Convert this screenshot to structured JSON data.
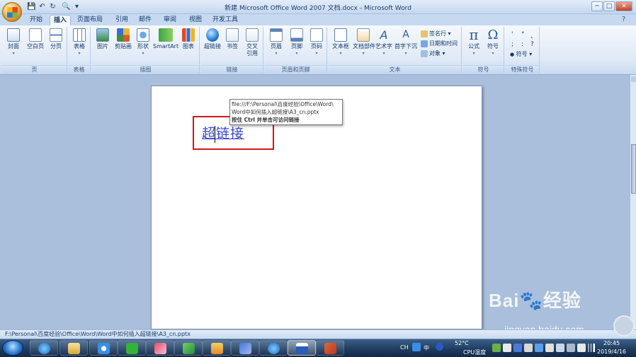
{
  "window": {
    "title": "新建 Microsoft Office Word 2007 文档.docx - Microsoft Word"
  },
  "quick_access": [
    {
      "icon": "save-icon",
      "glyph": "💾"
    },
    {
      "icon": "undo-icon",
      "glyph": "↶"
    },
    {
      "icon": "redo-icon",
      "glyph": "↻"
    },
    {
      "icon": "print-preview-icon",
      "glyph": "🔍"
    },
    {
      "icon": "customize-dropdown-icon",
      "glyph": "▾"
    }
  ],
  "window_controls": {
    "minimize": "─",
    "maximize": "□",
    "close": "✕",
    "restore": "▫",
    "close_doc": "x"
  },
  "tabs": [
    "开始",
    "插入",
    "页面布局",
    "引用",
    "邮件",
    "审阅",
    "视图",
    "开发工具"
  ],
  "active_tab": "插入",
  "ribbon": {
    "groups": [
      {
        "name": "页",
        "buttons": [
          "封面",
          "空白页",
          "分页"
        ]
      },
      {
        "name": "表格",
        "buttons": [
          "表格"
        ]
      },
      {
        "name": "插图",
        "buttons": [
          "图片",
          "剪贴画",
          "形状",
          "SmartArt",
          "图表"
        ]
      },
      {
        "name": "链接",
        "buttons": [
          "超链接",
          "书签",
          "交叉引用"
        ]
      },
      {
        "name": "页眉和页脚",
        "buttons": [
          "页眉",
          "页脚",
          "页码"
        ]
      },
      {
        "name": "文本",
        "buttons": [
          "文本框",
          "文档部件",
          "艺术字",
          "首字下沉"
        ],
        "small": [
          "签名行",
          "日期和时间",
          "对象"
        ]
      },
      {
        "name": "符号",
        "buttons": [
          "公式",
          "符号"
        ]
      },
      {
        "name": "特殊符号",
        "small": [
          "符号"
        ]
      }
    ],
    "special_symbols": [
      "'",
      "°",
      "、",
      ";",
      ":",
      "?"
    ]
  },
  "document": {
    "hyperlink_text": "超链接",
    "tooltip": {
      "line1": "file:///F:\\Personal\\百度经验\\Office\\Word\\",
      "line2": "Word中如何插入超链接\\A3_cn.pptx",
      "line3": "按住 Ctrl 并单击可访问链接"
    }
  },
  "statusbar": {
    "text": "F:\\Personal\\百度经验\\Office\\Word\\Word中如何插入超链接\\A3_cn.pptx"
  },
  "taskbar": {
    "apps": [
      "ie",
      "explorer",
      "baidu-netdisk",
      "iqiyi",
      "snipping",
      "media-player",
      "photo",
      "mail",
      "ie2",
      "word",
      "powerpoint"
    ],
    "tray": {
      "ime": "CH",
      "ime_mode": "中",
      "temp": "52°C",
      "temp_label": "CPU温度",
      "time": "20:45",
      "date": "2019/4/16"
    }
  },
  "watermark": {
    "brand": "Bai🐾经验",
    "sub": "jingyan.baidu.com"
  },
  "colors": {
    "accent": "#d3161b",
    "hyperlink": "#3848d0",
    "ribbon_bg": "#dfe9f6"
  }
}
